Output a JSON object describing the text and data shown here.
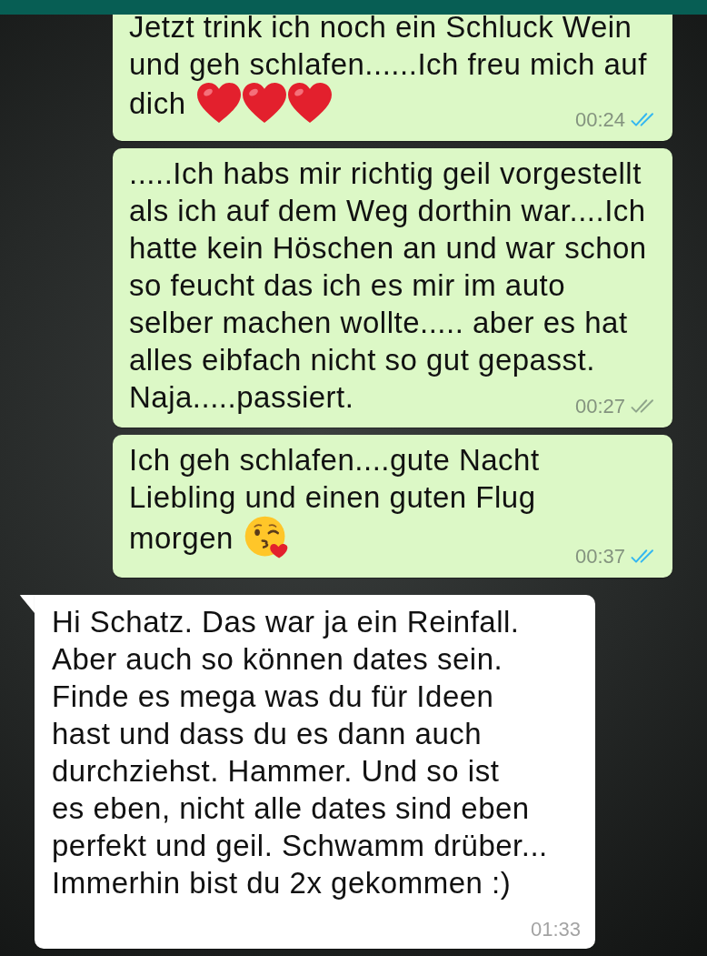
{
  "messages": [
    {
      "outgoing": true,
      "lines": [
        "Jetzt trink ich noch ein Schluck Wein",
        "und geh schlafen......Ich freu mich auf",
        "dich"
      ],
      "emojis": [
        {
          "kind": "heart"
        },
        {
          "kind": "heart"
        },
        {
          "kind": "heart"
        }
      ],
      "time": "00:24",
      "read": true
    },
    {
      "outgoing": true,
      "lines": [
        ".....Ich habs mir richtig geil vorgestellt",
        "als ich auf dem Weg dorthin war....Ich",
        "hatte kein Höschen an und war schon",
        "so feucht das ich es mir im auto",
        "selber machen wollte..... aber es hat",
        "alles eibfach nicht so gut gepasst.",
        "Naja.....passiert."
      ],
      "time": "00:27",
      "read": false
    },
    {
      "outgoing": true,
      "lines": [
        "Ich geh schlafen....gute Nacht",
        "Liebling und einen guten Flug",
        "morgen"
      ],
      "emojis": [
        {
          "kind": "kiss"
        }
      ],
      "time": "00:37",
      "read": true
    },
    {
      "outgoing": false,
      "lines": [
        "Hi Schatz. Das war ja ein Reinfall.",
        "Aber auch so können dates sein.",
        "Finde es mega was du für Ideen",
        "hast und dass du es dann auch",
        "durchziehst. Hammer. Und so ist",
        "es eben, nicht alle dates sind eben",
        "perfekt und geil. Schwamm drüber...",
        "Immerhin bist du 2x gekommen :)"
      ],
      "time": "01:33"
    }
  ]
}
